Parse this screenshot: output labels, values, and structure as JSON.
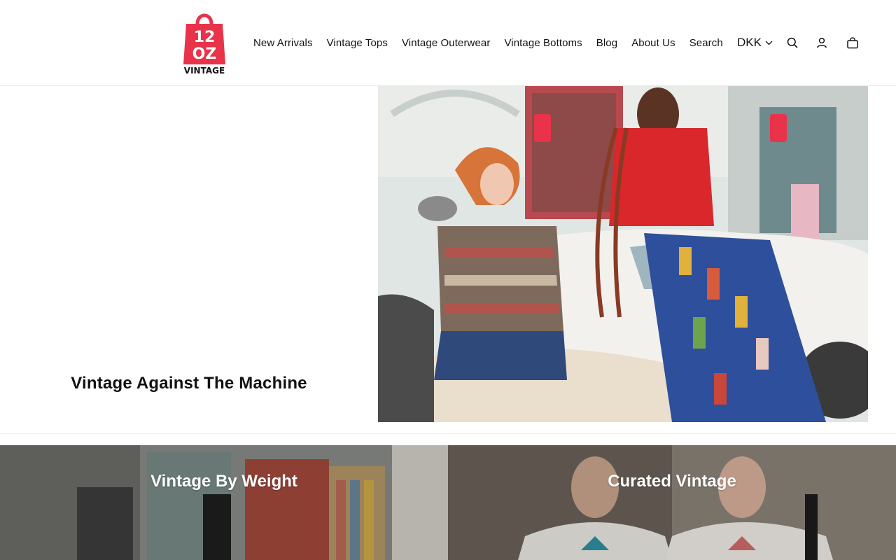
{
  "logo": {
    "line1": "12",
    "line2": "OZ",
    "line3": "VINTAGE",
    "color": "#e8334a"
  },
  "nav": {
    "items": [
      "New Arrivals",
      "Vintage Tops",
      "Vintage Outerwear",
      "Vintage Bottoms",
      "Blog",
      "About Us",
      "Search"
    ]
  },
  "header": {
    "currency": "DKK",
    "icons": [
      "search-icon",
      "account-icon",
      "cart-icon"
    ]
  },
  "hero": {
    "title": "Vintage Against The Machine"
  },
  "collections": [
    {
      "title": "Vintage By Weight"
    },
    {
      "title": "Curated Vintage"
    }
  ]
}
